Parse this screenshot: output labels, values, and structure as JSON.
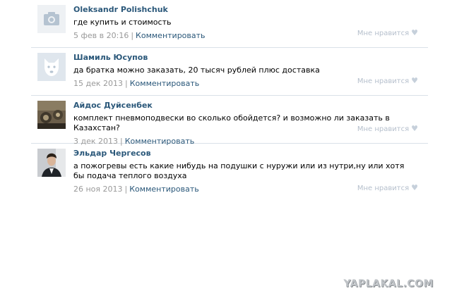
{
  "comments": [
    {
      "author": "Oleksandr Polishchuk",
      "text": "где купить и стоимость",
      "date": "5 фев в 20:16",
      "reply": "Комментировать",
      "like": "Мне нравится",
      "avatar_icon": "camera-placeholder-icon"
    },
    {
      "author": "Шамиль Юсупов",
      "text": "да братка можно заказать, 20 тысяч рублей плюс доставка",
      "date": "15 дек 2013",
      "reply": "Комментировать",
      "like": "Мне нравится",
      "avatar_icon": "vk-dog-icon"
    },
    {
      "author": "Айдос Дуйсенбек",
      "text": "комплект пневмоподвески во сколько обойдется? и возможно ли заказать в Казахстан?",
      "date": "3 дек 2013",
      "reply": "Комментировать",
      "like": "Мне нравится",
      "avatar_icon": "user-photo"
    },
    {
      "author": "Эльдар Чергесов",
      "text": "а пожогревы есть какие нибудь на подушки с нуружи или из нутри,ну или хотя бы подача теплого воздуха",
      "date": "26 ноя 2013",
      "reply": "Комментировать",
      "like": "Мне нравится",
      "avatar_icon": "user-photo"
    }
  ],
  "watermark": "YAPLAKAL.COM",
  "colors": {
    "link": "#2b587a",
    "meta": "#999999",
    "divider": "#dae1e8"
  }
}
